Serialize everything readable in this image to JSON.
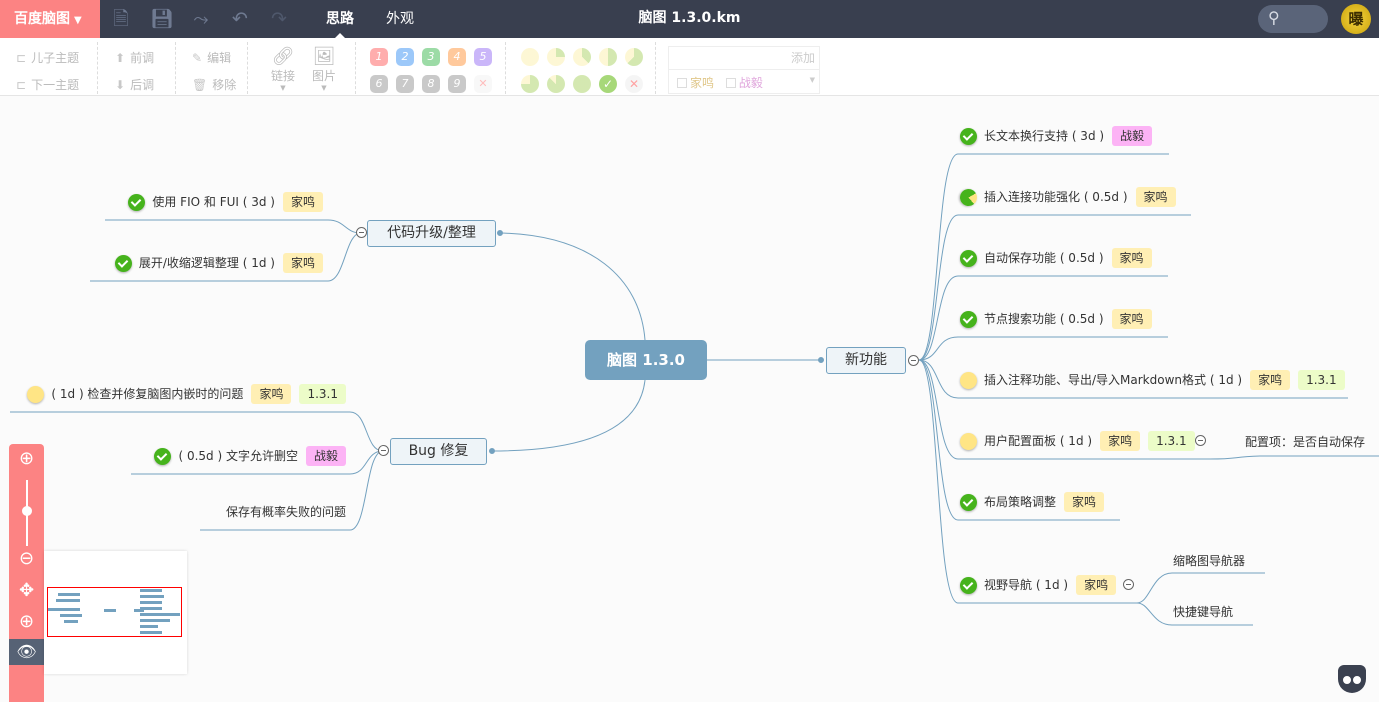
{
  "app": {
    "logo": "百度脑图",
    "title": "脑图 1.3.0.km",
    "tabs": [
      {
        "label": "思路",
        "active": true
      },
      {
        "label": "外观",
        "active": false
      }
    ],
    "icons": [
      "new-file-icon",
      "save-icon",
      "share-icon",
      "undo-icon",
      "redo-icon",
      "search-icon",
      "avatar"
    ]
  },
  "toolbar": {
    "child_topic": "儿子主题",
    "next_topic": "下一主题",
    "move_up": "前调",
    "move_down": "后调",
    "edit": "编辑",
    "remove": "移除",
    "link": "链接",
    "image": "图片",
    "priorities": [
      "1",
      "2",
      "3",
      "4",
      "5",
      "6",
      "7",
      "8",
      "9"
    ],
    "priority_colors": [
      "#ff6b6b",
      "#4d9cf5",
      "#4dbf5f",
      "#ff9e4d",
      "#a07cf5",
      "#9e9e9e",
      "#9e9e9e",
      "#9e9e9e",
      "#9e9e9e"
    ],
    "tag_add": "添加",
    "tag_options": [
      "家鸣",
      "战毅"
    ]
  },
  "mindmap": {
    "root": "脑图 1.3.0",
    "right": {
      "label": "新功能",
      "children": [
        {
          "text": "长文本换行支持 ( 3d )",
          "progress": "done",
          "tags": [
            {
              "t": "战毅",
              "c": "p"
            }
          ]
        },
        {
          "text": "插入连接功能强化 ( 0.5d )",
          "progress": "partial",
          "tags": [
            {
              "t": "家鸣",
              "c": "y"
            }
          ]
        },
        {
          "text": "自动保存功能 ( 0.5d )",
          "progress": "done",
          "tags": [
            {
              "t": "家鸣",
              "c": "y"
            }
          ]
        },
        {
          "text": "节点搜索功能 ( 0.5d )",
          "progress": "done",
          "tags": [
            {
              "t": "家鸣",
              "c": "y"
            }
          ]
        },
        {
          "text": "插入注释功能、导出/导入Markdown格式 ( 1d )",
          "progress": "none",
          "tags": [
            {
              "t": "家鸣",
              "c": "y"
            },
            {
              "t": "1.3.1",
              "c": "g"
            }
          ]
        },
        {
          "text": "用户配置面板 ( 1d )",
          "progress": "none",
          "tags": [
            {
              "t": "家鸣",
              "c": "y"
            },
            {
              "t": "1.3.1",
              "c": "g"
            }
          ],
          "children": [
            "配置项：是否自动保存"
          ]
        },
        {
          "text": "布局策略调整",
          "progress": "done",
          "tags": [
            {
              "t": "家鸣",
              "c": "y"
            }
          ]
        },
        {
          "text": "视野导航 ( 1d )",
          "progress": "done",
          "tags": [
            {
              "t": "家鸣",
              "c": "y"
            }
          ],
          "children": [
            "缩略图导航器",
            "快捷键导航"
          ]
        }
      ]
    },
    "left_top": {
      "label": "代码升级/整理",
      "children": [
        {
          "text": "使用 FIO 和 FUI ( 3d )",
          "progress": "done",
          "tags": [
            {
              "t": "家鸣",
              "c": "y"
            }
          ]
        },
        {
          "text": "展开/收缩逻辑整理 ( 1d )",
          "progress": "done",
          "tags": [
            {
              "t": "家鸣",
              "c": "y"
            }
          ]
        }
      ]
    },
    "left_bottom": {
      "label": "Bug 修复",
      "children": [
        {
          "text": "( 1d ) 检查并修复脑图内嵌时的问题",
          "progress": "none",
          "tags": [
            {
              "t": "家鸣",
              "c": "y"
            },
            {
              "t": "1.3.1",
              "c": "g"
            }
          ]
        },
        {
          "text": "( 0.5d ) 文字允许删空",
          "progress": "done",
          "tags": [
            {
              "t": "战毅",
              "c": "p"
            }
          ]
        },
        {
          "text": "保存有概率失败的问题",
          "progress": null,
          "tags": []
        }
      ]
    }
  },
  "zoom_controls": {
    "zoom_level_fraction": 0.5
  }
}
